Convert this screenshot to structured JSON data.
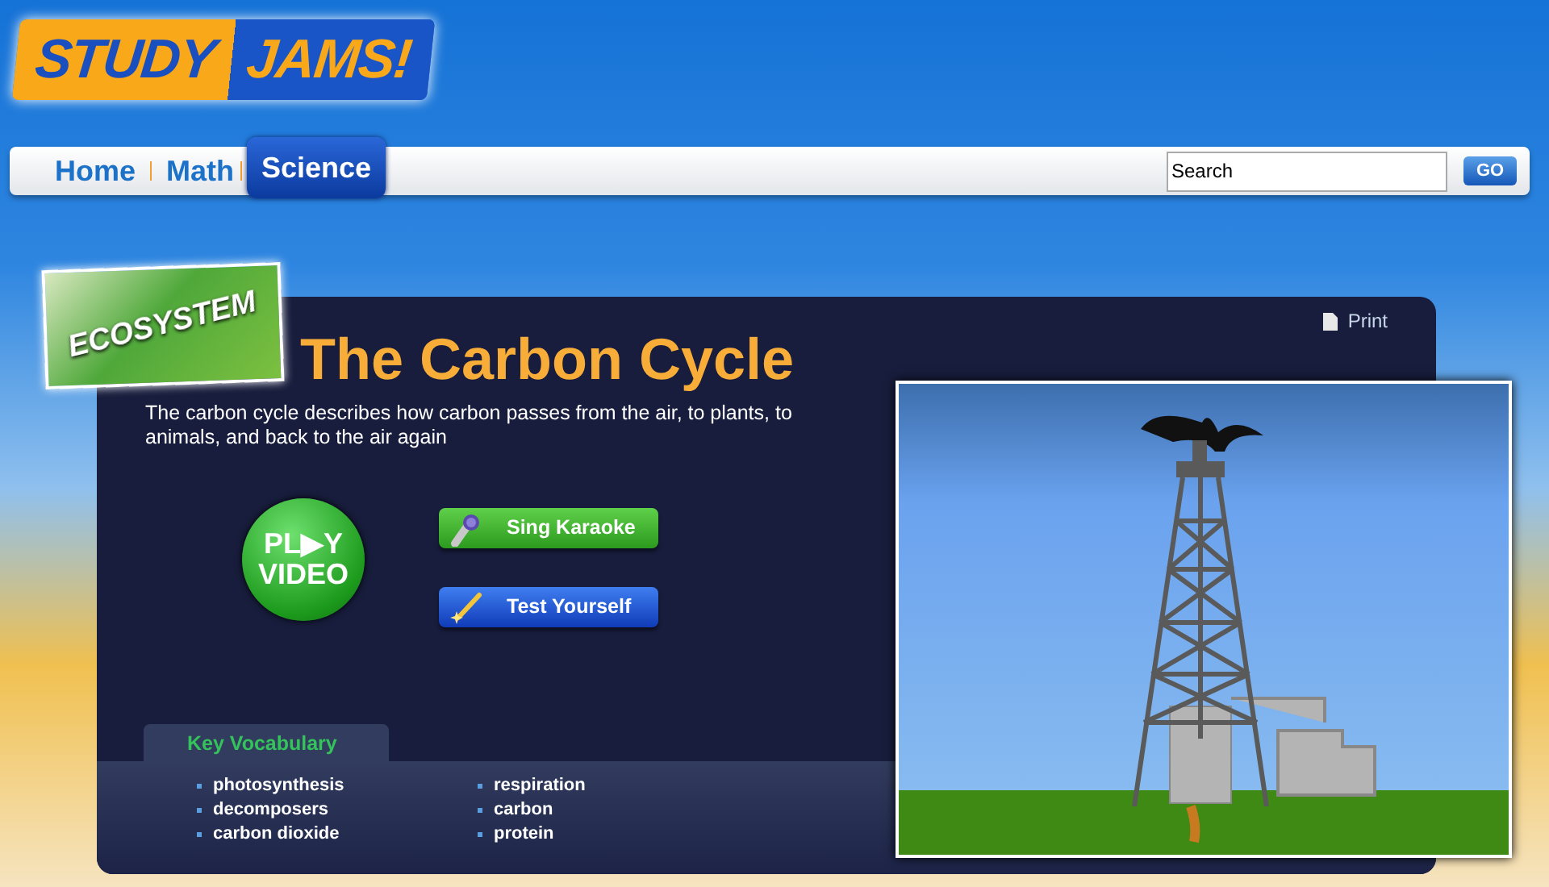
{
  "logo": {
    "word_1": "STUDY",
    "word_2": "JAMS!"
  },
  "nav": {
    "tabs": [
      {
        "label": "Home",
        "selected": false
      },
      {
        "label": "Math",
        "selected": false
      },
      {
        "label": "Science",
        "selected": true
      }
    ],
    "search": {
      "value": "Search"
    },
    "go_button": "GO"
  },
  "badge": "ECOSYSTEM",
  "print": "Print",
  "title": "The Carbon Cycle",
  "description": "The carbon cycle describes how carbon passes from the air, to plants, to animals, and back to the air again",
  "play_video": [
    "PL▶Y",
    "VIDEO"
  ],
  "buttons": [
    {
      "kind": "karaoke",
      "label": "Sing Karaoke"
    },
    {
      "kind": "test",
      "label": "Test Yourself"
    }
  ],
  "vocabulary": {
    "title": "Key Vocabulary",
    "columns": [
      [
        "photosynthesis",
        "decomposers",
        "carbon dioxide"
      ],
      [
        "respiration",
        "carbon",
        "protein"
      ]
    ]
  }
}
